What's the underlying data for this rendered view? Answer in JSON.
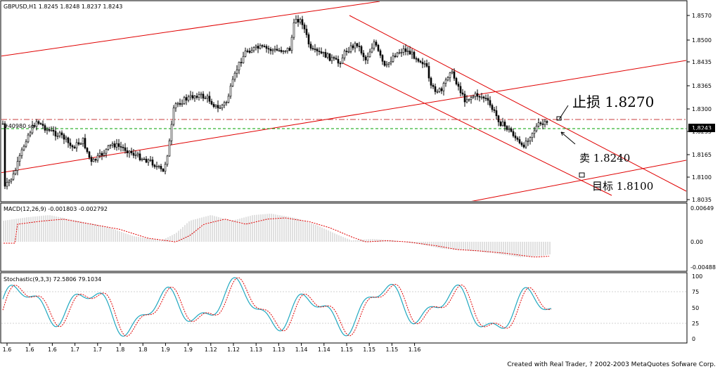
{
  "window": {
    "symbol_title": "GBPUSD,H1  1.8245 1.8248 1.8237 1.8243",
    "order_label": "#40980 se",
    "footer": "Created with Real Trader, ? 2002-2003 MetaQuotes Sofware Corp."
  },
  "price_panel": {
    "price_ticks": [
      "1.8570",
      "1.8500",
      "1.8435",
      "1.8365",
      "1.8300",
      "1.8235",
      "1.8165",
      "1.8100",
      "1.8035"
    ],
    "current_price_label": "1.8243",
    "annotations": {
      "stop_loss": "止损 1.8270",
      "sell": "卖 1.8240",
      "take_profit": "目标 1.8100"
    }
  },
  "macd_panel": {
    "title": "MACD(12,26,9)  -0.001803  -0.002792",
    "ticks": [
      "0.00649",
      "0.00",
      "-0.00488"
    ]
  },
  "stoch_panel": {
    "title": "Stochastic(9,3,3)  72.5806  79.1034",
    "ticks": [
      "100",
      "75",
      "50",
      "25",
      "0"
    ]
  },
  "time_axis": {
    "labels": [
      "1.6",
      "1.6",
      "1.6",
      "1.7",
      "1.7",
      "1.8",
      "1.8",
      "1.9",
      "1.9",
      "1.12",
      "1.12",
      "1.13",
      "1.13",
      "1.14",
      "1.14",
      "1.15",
      "1.15",
      "1.15",
      "1.16"
    ]
  },
  "colors": {
    "background": "#ffffff",
    "candles": "#000000",
    "channel_lines": "#e00000",
    "stop_line": "#c83c3c",
    "sell_line": "#00a000",
    "macd_hist": "#c0c0c0",
    "macd_signal": "#e00000",
    "stoch_main": "#20a8c0",
    "stoch_signal": "#e00000",
    "price_badge": "#000000"
  }
}
